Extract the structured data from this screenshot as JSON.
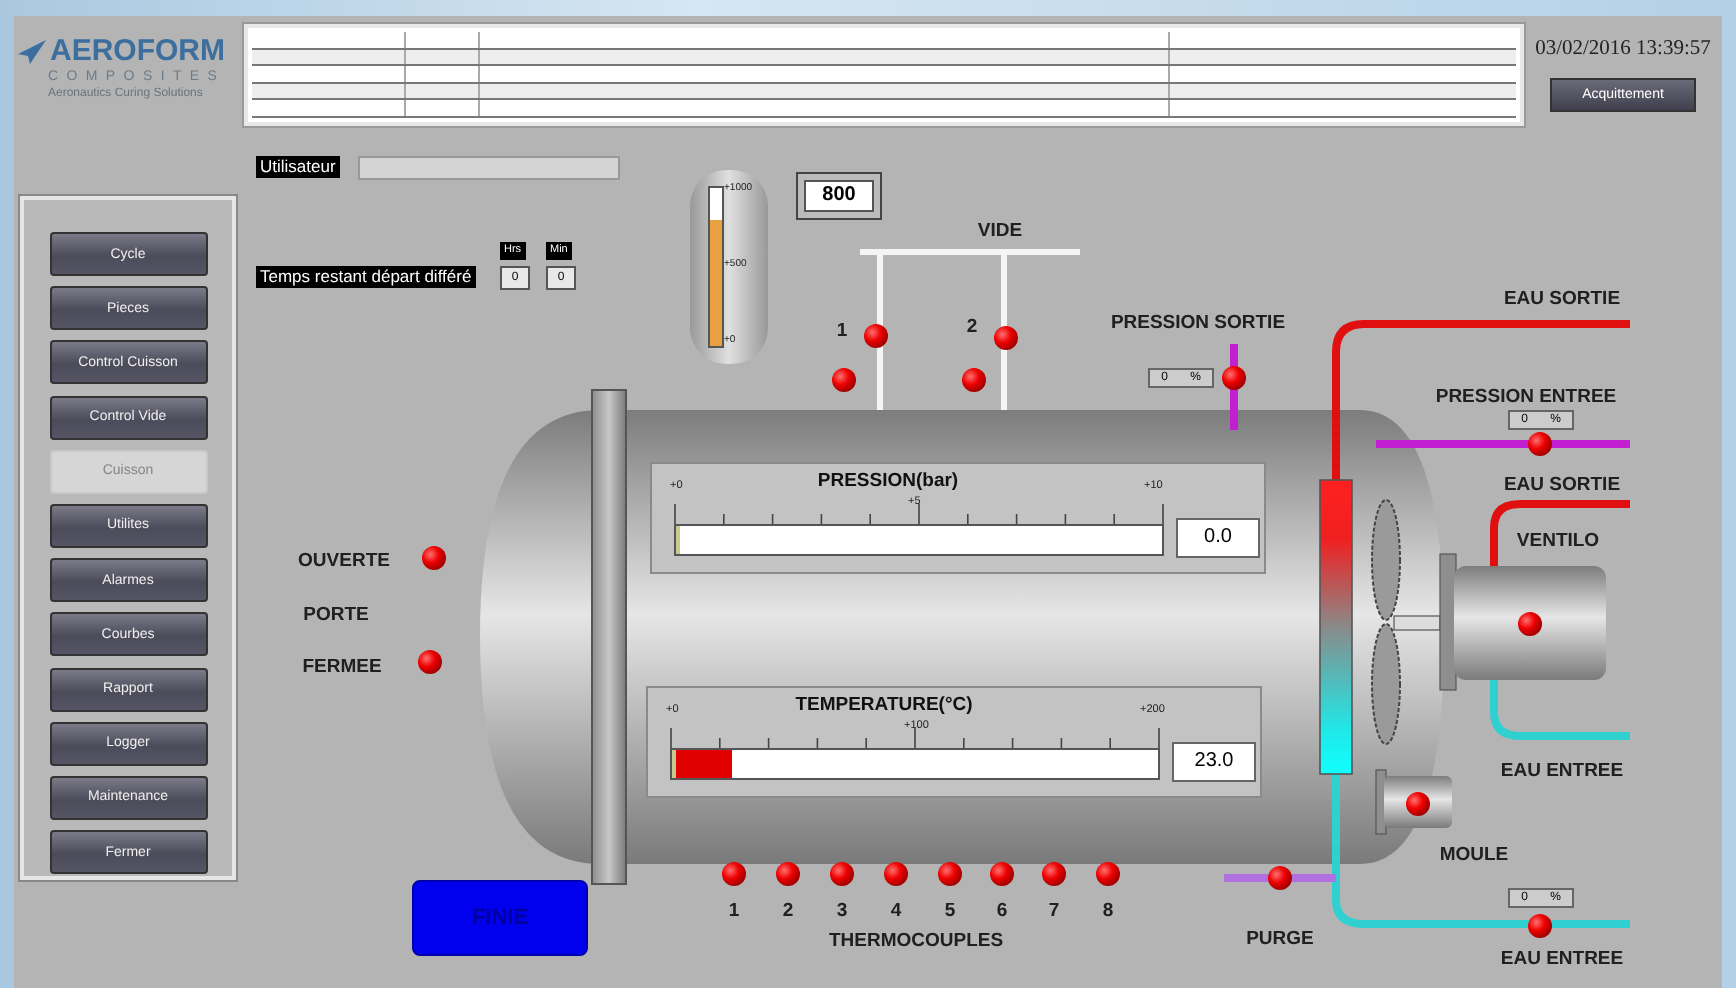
{
  "logo": {
    "name": "AEROFORM",
    "subtitle": "COMPOSITES",
    "tagline": "Aeronautics Curing Solutions"
  },
  "datetime": "03/02/2016 13:39:57",
  "ack_button": "Acquittement",
  "user": {
    "label": "Utilisateur"
  },
  "delay": {
    "label": "Temps restant départ différé",
    "hours_label": "Hrs",
    "hours": "0",
    "minutes_label": "Min",
    "minutes": "0"
  },
  "menu": [
    {
      "label": "Cycle",
      "disabled": false
    },
    {
      "label": "Pieces",
      "disabled": false
    },
    {
      "label": "Control Cuisson",
      "disabled": false
    },
    {
      "label": "Control Vide",
      "disabled": false
    },
    {
      "label": "Cuisson",
      "disabled": true
    },
    {
      "label": "Utilites",
      "disabled": false
    },
    {
      "label": "Alarmes",
      "disabled": false
    },
    {
      "label": "Courbes",
      "disabled": false
    },
    {
      "label": "Rapport",
      "disabled": false
    },
    {
      "label": "Logger",
      "disabled": false
    },
    {
      "label": "Maintenance",
      "disabled": false
    },
    {
      "label": "Fermer",
      "disabled": false
    }
  ],
  "vacuum_gauge": {
    "ticks": [
      "+1000",
      "+500",
      "+0"
    ],
    "level": 0.8,
    "value": "800"
  },
  "vide": {
    "label": "VIDE",
    "valves": [
      "1",
      "2"
    ]
  },
  "door": {
    "open_label": "OUVERTE",
    "label": "PORTE",
    "closed_label": "FERMEE"
  },
  "pressure": {
    "title": "PRESSION(bar)",
    "ticks": [
      "+0",
      "+5",
      "+10"
    ],
    "level": 0,
    "value": "0.0"
  },
  "temperature": {
    "title": "TEMPERATURE(°C)",
    "ticks": [
      "+0",
      "+100",
      "+200"
    ],
    "level": 0.115,
    "value": "23.0"
  },
  "status_button": "FINIE",
  "thermocouples": {
    "label": "THERMOCOUPLES",
    "items": [
      "1",
      "2",
      "3",
      "4",
      "5",
      "6",
      "7",
      "8"
    ]
  },
  "pressure_out": {
    "label": "PRESSION SORTIE",
    "value": "0",
    "unit": "%"
  },
  "water_out_top": {
    "label": "EAU SORTIE"
  },
  "pressure_in": {
    "label": "PRESSION ENTREE",
    "value": "0",
    "unit": "%"
  },
  "water_out_fan": {
    "label": "EAU SORTIE"
  },
  "fan": {
    "label": "VENTILO"
  },
  "water_in_fan": {
    "label": "EAU ENTREE"
  },
  "mold": {
    "label": "MOULE"
  },
  "purge": {
    "label": "PURGE"
  },
  "water_in_bottom": {
    "label": "EAU ENTREE",
    "value": "0",
    "unit": "%"
  }
}
